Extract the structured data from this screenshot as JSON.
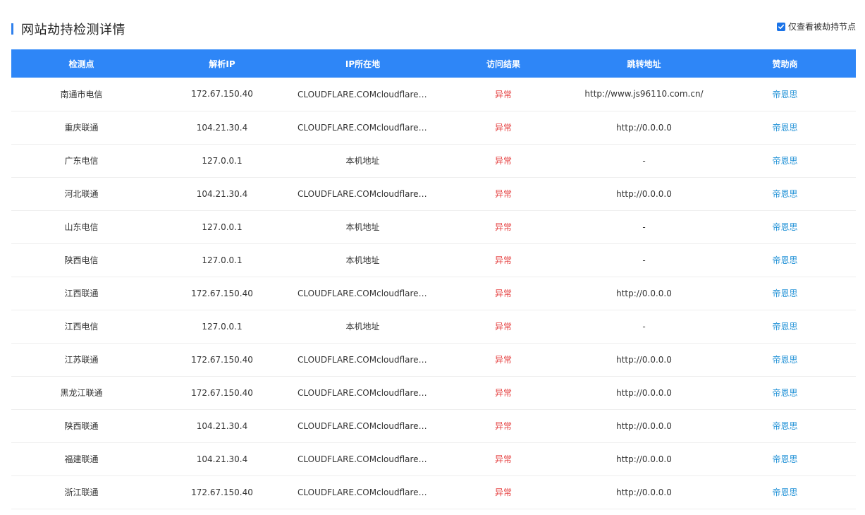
{
  "section": {
    "title": "网站劫持检测详情",
    "filter_label": "仅查看被劫持节点",
    "filter_checked": true,
    "accent_color": "#2f80ed"
  },
  "table": {
    "header_color": "#2e86f7",
    "columns": [
      "检测点",
      "解析IP",
      "IP所在地",
      "访问结果",
      "跳转地址",
      "赞助商"
    ],
    "rows": [
      {
        "point": "南通市电信",
        "ip": "172.67.150.40",
        "location": "CLOUDFLARE.COMcloudflare.com",
        "result": "异常",
        "redirect": "http://www.js96110.com.cn/",
        "sponsor": "帝恩思"
      },
      {
        "point": "重庆联通",
        "ip": "104.21.30.4",
        "location": "CLOUDFLARE.COMcloudflare.com",
        "result": "异常",
        "redirect": "http://0.0.0.0",
        "sponsor": "帝恩思"
      },
      {
        "point": "广东电信",
        "ip": "127.0.0.1",
        "location": "本机地址",
        "result": "异常",
        "redirect": "-",
        "sponsor": "帝恩思"
      },
      {
        "point": "河北联通",
        "ip": "104.21.30.4",
        "location": "CLOUDFLARE.COMcloudflare.com",
        "result": "异常",
        "redirect": "http://0.0.0.0",
        "sponsor": "帝恩思"
      },
      {
        "point": "山东电信",
        "ip": "127.0.0.1",
        "location": "本机地址",
        "result": "异常",
        "redirect": "-",
        "sponsor": "帝恩思"
      },
      {
        "point": "陕西电信",
        "ip": "127.0.0.1",
        "location": "本机地址",
        "result": "异常",
        "redirect": "-",
        "sponsor": "帝恩思"
      },
      {
        "point": "江西联通",
        "ip": "172.67.150.40",
        "location": "CLOUDFLARE.COMcloudflare.com",
        "result": "异常",
        "redirect": "http://0.0.0.0",
        "sponsor": "帝恩思"
      },
      {
        "point": "江西电信",
        "ip": "127.0.0.1",
        "location": "本机地址",
        "result": "异常",
        "redirect": "-",
        "sponsor": "帝恩思"
      },
      {
        "point": "江苏联通",
        "ip": "172.67.150.40",
        "location": "CLOUDFLARE.COMcloudflare.com",
        "result": "异常",
        "redirect": "http://0.0.0.0",
        "sponsor": "帝恩思"
      },
      {
        "point": "黑龙江联通",
        "ip": "172.67.150.40",
        "location": "CLOUDFLARE.COMcloudflare.com",
        "result": "异常",
        "redirect": "http://0.0.0.0",
        "sponsor": "帝恩思"
      },
      {
        "point": "陕西联通",
        "ip": "104.21.30.4",
        "location": "CLOUDFLARE.COMcloudflare.com",
        "result": "异常",
        "redirect": "http://0.0.0.0",
        "sponsor": "帝恩思"
      },
      {
        "point": "福建联通",
        "ip": "104.21.30.4",
        "location": "CLOUDFLARE.COMcloudflare.com",
        "result": "异常",
        "redirect": "http://0.0.0.0",
        "sponsor": "帝恩思"
      },
      {
        "point": "浙江联通",
        "ip": "172.67.150.40",
        "location": "CLOUDFLARE.COMcloudflare.com",
        "result": "异常",
        "redirect": "http://0.0.0.0",
        "sponsor": "帝恩思"
      }
    ]
  }
}
